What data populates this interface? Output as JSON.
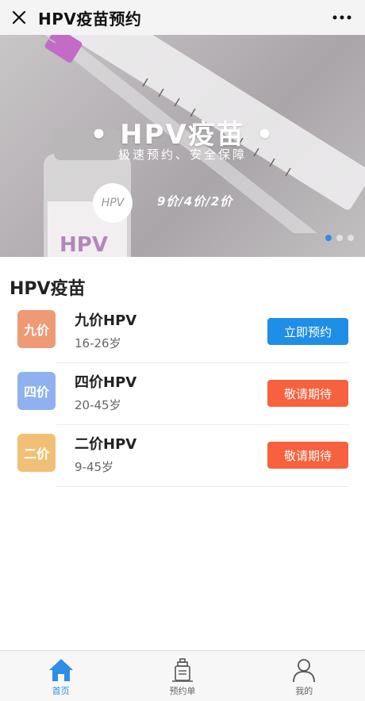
{
  "header": {
    "title": "HPV疫苗预约"
  },
  "banner": {
    "title": "• HPV疫苗 •",
    "subtitle": "极速预约、安全保障",
    "badge": "HPV",
    "prices": "9价/4价/2价",
    "slides": 3,
    "active_slide": 1,
    "bottle_label": "HPV"
  },
  "section": {
    "title": "HPV疫苗"
  },
  "vaccines": [
    {
      "badge": "九价",
      "name": "九价HPV",
      "age": "16-26岁",
      "button": "立即预约",
      "badge_color": "#ee9a74",
      "button_color": "#1f8ee6"
    },
    {
      "badge": "四价",
      "name": "四价HPV",
      "age": "20-45岁",
      "button": "敬请期待",
      "badge_color": "#8fb1ef",
      "button_color": "#f7613d"
    },
    {
      "badge": "二价",
      "name": "二价HPV",
      "age": "9-45岁",
      "button": "敬请期待",
      "badge_color": "#f1c077",
      "button_color": "#f7613d"
    }
  ],
  "tabbar": [
    {
      "label": "首页",
      "icon": "home-icon",
      "active": true
    },
    {
      "label": "预约单",
      "icon": "vaccine-bottle-icon",
      "active": false
    },
    {
      "label": "我的",
      "icon": "user-icon",
      "active": false
    }
  ],
  "colors": {
    "accent": "#2f8de4",
    "cta_blue": "#1f8ee6",
    "cta_orange": "#f7613d"
  }
}
